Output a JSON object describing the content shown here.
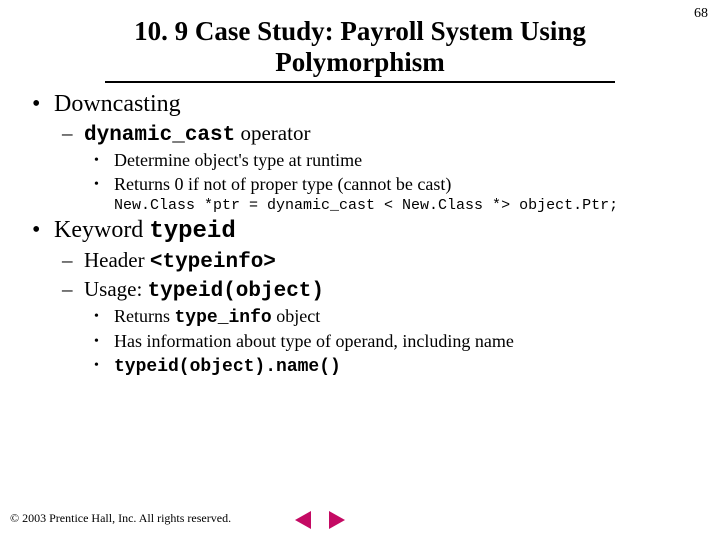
{
  "page_number": "68",
  "title_line1": "10. 9  Case Study: Payroll System Using",
  "title_line2": "Polymorphism",
  "b1": {
    "text": "Downcasting",
    "s1": {
      "pre": "",
      "code": "dynamic_cast",
      "post": " operator"
    },
    "p1": "Determine object's type at runtime",
    "p2": "Returns 0 if not of proper type (cannot be cast)",
    "codeline": "New.Class *ptr = dynamic_cast < New.Class *> object.Ptr;"
  },
  "b2": {
    "pre": "Keyword ",
    "code": "typeid",
    "s1": {
      "pre": "Header ",
      "code": "<typeinfo>"
    },
    "s2": {
      "pre": "Usage: ",
      "code": "typeid(object)"
    },
    "p1": {
      "pre": "Returns ",
      "code": "type_info",
      "post": " object"
    },
    "p2": "Has information about type of operand, including name",
    "p3": "typeid(object).name()"
  },
  "footer": "© 2003 Prentice Hall, Inc.  All rights reserved."
}
